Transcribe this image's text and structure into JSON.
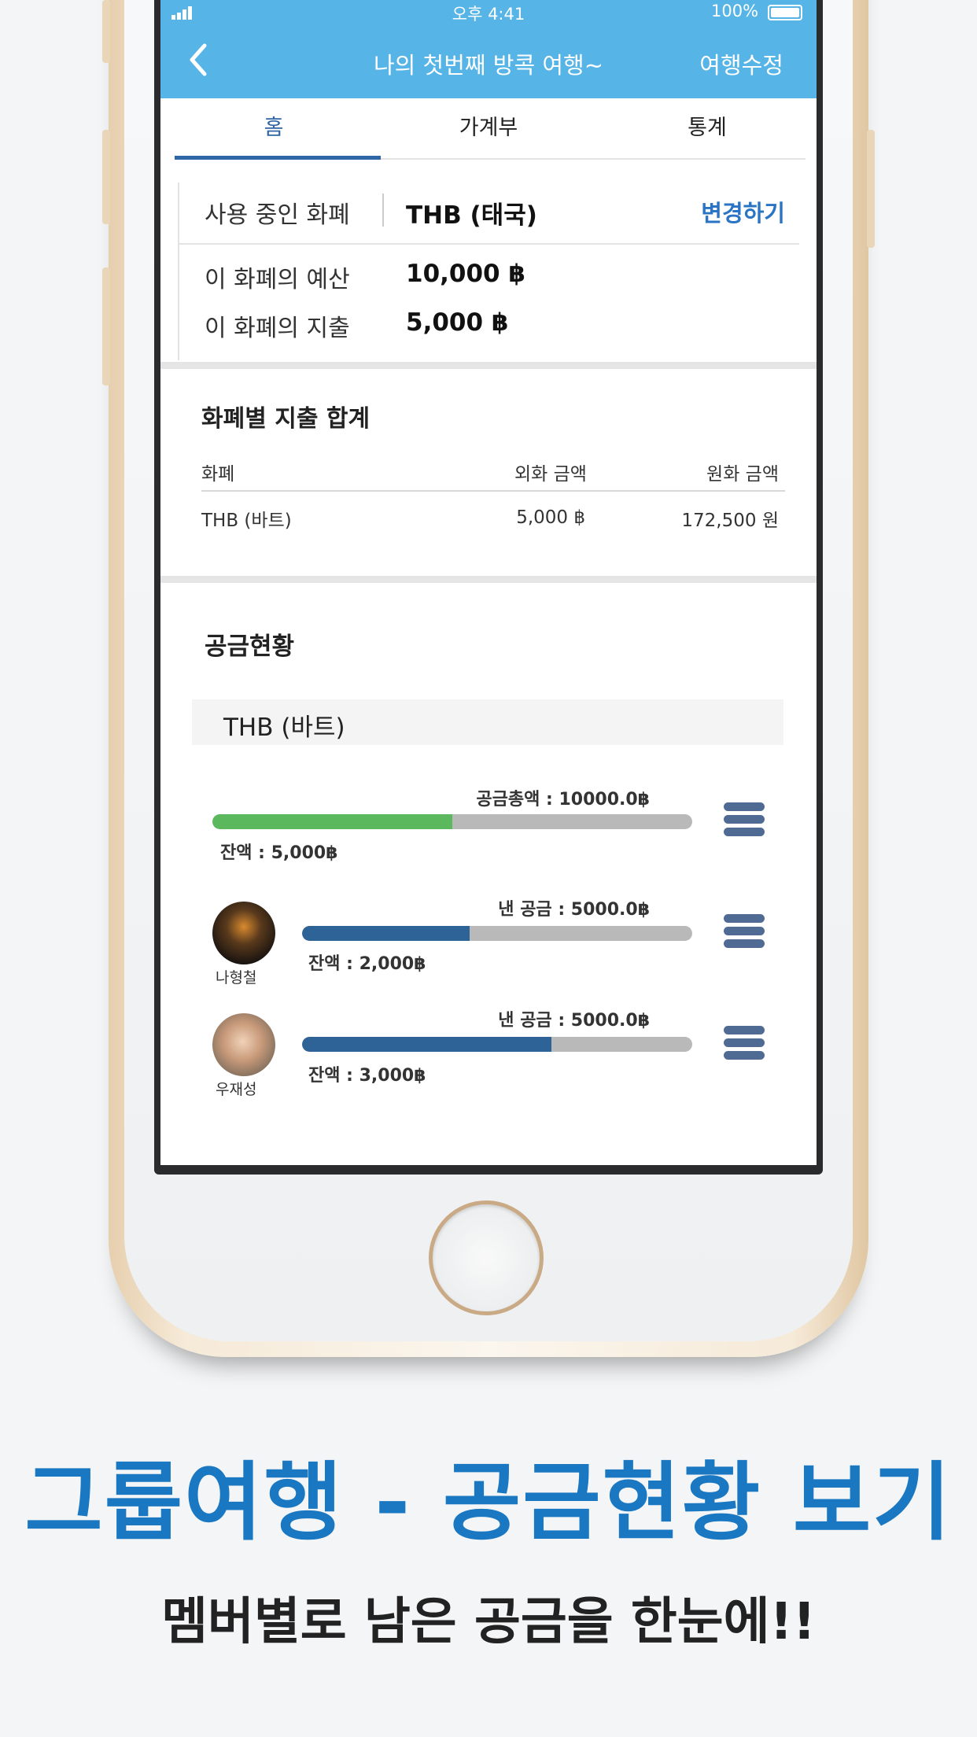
{
  "status": {
    "time": "오후 4:41",
    "battery": "100%"
  },
  "nav": {
    "back_icon": "chevron-left-icon",
    "title": "나의 첫번째 방콕 여행~",
    "edit_label": "여행수정"
  },
  "tabs": [
    {
      "label": "홈"
    },
    {
      "label": "가계부"
    },
    {
      "label": "통계"
    }
  ],
  "currency_info": {
    "label": "사용 중인 화폐",
    "value": "THB (태국)",
    "change_label": "변경하기",
    "budget_label": "이 화폐의 예산",
    "budget_value": "10,000 ฿",
    "spend_label": "이 화폐의 지출",
    "spend_value": "5,000 ฿"
  },
  "spend_summary": {
    "title": "화폐별 지출 합계",
    "columns": [
      "화폐",
      "외화 금액",
      "원화 금액"
    ],
    "rows": [
      {
        "currency": "THB (바트)",
        "foreign": "5,000 ฿",
        "krw": "172,500 원"
      }
    ]
  },
  "fund": {
    "title": "공금현황",
    "currency_header": "THB (바트)",
    "total": {
      "label": "공금총액 : 10000.0฿",
      "balance": "잔액 : 5,000฿",
      "fill": 0.5,
      "color": "#5cb85c"
    },
    "members": [
      {
        "name": "나형철",
        "paid": "낸 공금 : 5000.0฿",
        "balance": "잔액 : 2,000฿",
        "fill": 0.43,
        "color": "#2e6398"
      },
      {
        "name": "우재성",
        "paid": "낸 공금 : 5000.0฿",
        "balance": "잔액 : 3,000฿",
        "fill": 0.64,
        "color": "#2e6398"
      }
    ]
  },
  "promo": {
    "headline": "그룹여행 - 공금현황 보기",
    "subline": "멤버별로 남은 공금을 한눈에!!"
  }
}
